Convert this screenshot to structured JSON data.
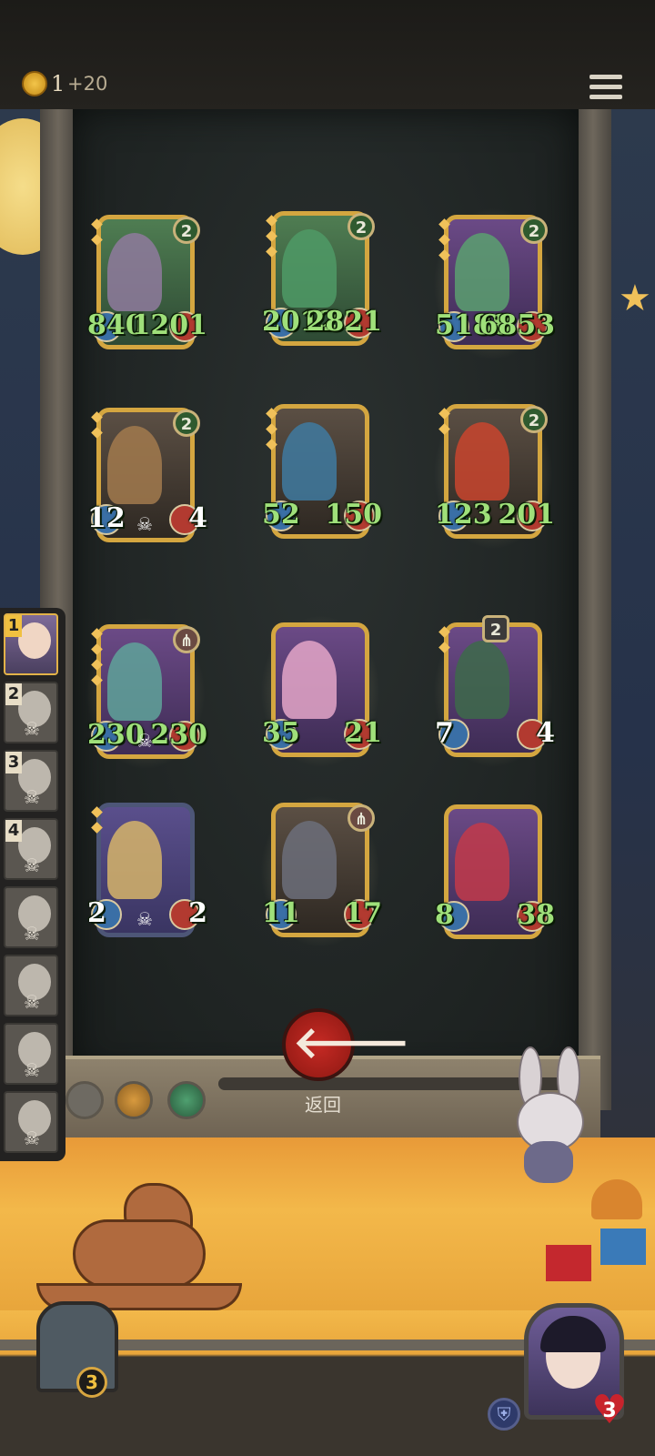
{
  "header": {
    "coins": "1",
    "coin_bonus": "+20"
  },
  "cards": [
    {
      "attack": "840",
      "health": "1201",
      "tier": "2",
      "badge": "tier",
      "color": "green",
      "glow": false,
      "stat_color": "green",
      "skull": false,
      "gems": 2,
      "portrait": "#8f7a9e"
    },
    {
      "attack": "2012",
      "health": "2821",
      "tier": "2",
      "badge": "tier",
      "color": "green",
      "glow": false,
      "stat_color": "green",
      "skull": false,
      "gems": 3,
      "portrait": "#4f9a66"
    },
    {
      "attack": "5188",
      "health": "6853",
      "tier": "2",
      "badge": "tier",
      "color": "purple",
      "glow": true,
      "stat_color": "green",
      "skull": false,
      "gems": 3,
      "portrait": "#5aa070"
    },
    {
      "attack": "12",
      "health": "4",
      "tier": "2",
      "badge": "tier",
      "color": "dark",
      "glow": false,
      "stat_color": "white",
      "skull": true,
      "gems": 2,
      "portrait": "#a27a4e"
    },
    {
      "attack": "52",
      "health": "150",
      "tier": "",
      "badge": "none",
      "color": "dark",
      "glow": false,
      "stat_color": "green",
      "skull": false,
      "gems": 3,
      "portrait": "#3f7aa0"
    },
    {
      "attack": "123",
      "health": "201",
      "tier": "2",
      "badge": "tier",
      "color": "dark",
      "glow": true,
      "stat_color": "green",
      "skull": false,
      "gems": 2,
      "portrait": "#c9452e"
    },
    {
      "attack": "230",
      "health": "230",
      "tier": "",
      "badge": "claw",
      "color": "purple",
      "glow": true,
      "stat_color": "green",
      "skull": true,
      "gems": 4,
      "portrait": "#5fa39a"
    },
    {
      "attack": "35",
      "health": "21",
      "tier": "",
      "badge": "none",
      "color": "purple",
      "glow": true,
      "stat_color": "green",
      "skull": false,
      "gems": 0,
      "portrait": "#e4a6c8"
    },
    {
      "attack": "7",
      "health": "4",
      "tier": "2",
      "badge": "shield",
      "color": "purple",
      "glow": true,
      "stat_color": "white",
      "skull": false,
      "gems": 2,
      "portrait": "#3d6a4a"
    },
    {
      "attack": "2",
      "health": "2",
      "tier": "",
      "badge": "none",
      "color": "blue",
      "glow": false,
      "stat_color": "white",
      "skull": true,
      "gems": 2,
      "portrait": "#d6b46a"
    },
    {
      "attack": "11",
      "health": "17",
      "tier": "",
      "badge": "claw",
      "color": "dark",
      "glow": true,
      "stat_color": "green",
      "skull": false,
      "gems": 0,
      "portrait": "#6c6f7a"
    },
    {
      "attack": "8",
      "health": "38",
      "tier": "",
      "badge": "none",
      "color": "purple",
      "glow": false,
      "stat_color": "green",
      "skull": false,
      "gems": 0,
      "portrait": "#c23a4a"
    }
  ],
  "players": [
    {
      "rank": "1",
      "active": true
    },
    {
      "rank": "2",
      "active": false
    },
    {
      "rank": "3",
      "active": false
    },
    {
      "rank": "4",
      "active": false
    },
    {
      "rank": "",
      "active": false
    },
    {
      "rank": "",
      "active": false
    },
    {
      "rank": "",
      "active": false
    },
    {
      "rank": "",
      "active": false
    }
  ],
  "back": {
    "label": "返回",
    "icon": "arrow-left-icon"
  },
  "hero": {
    "level": "3"
  },
  "player": {
    "health": "3"
  },
  "colors": {
    "stat_green": "#9fe07a",
    "frame_gold": "#d4a640",
    "back_red": "#c62a24",
    "floor": "#f3b84a"
  }
}
